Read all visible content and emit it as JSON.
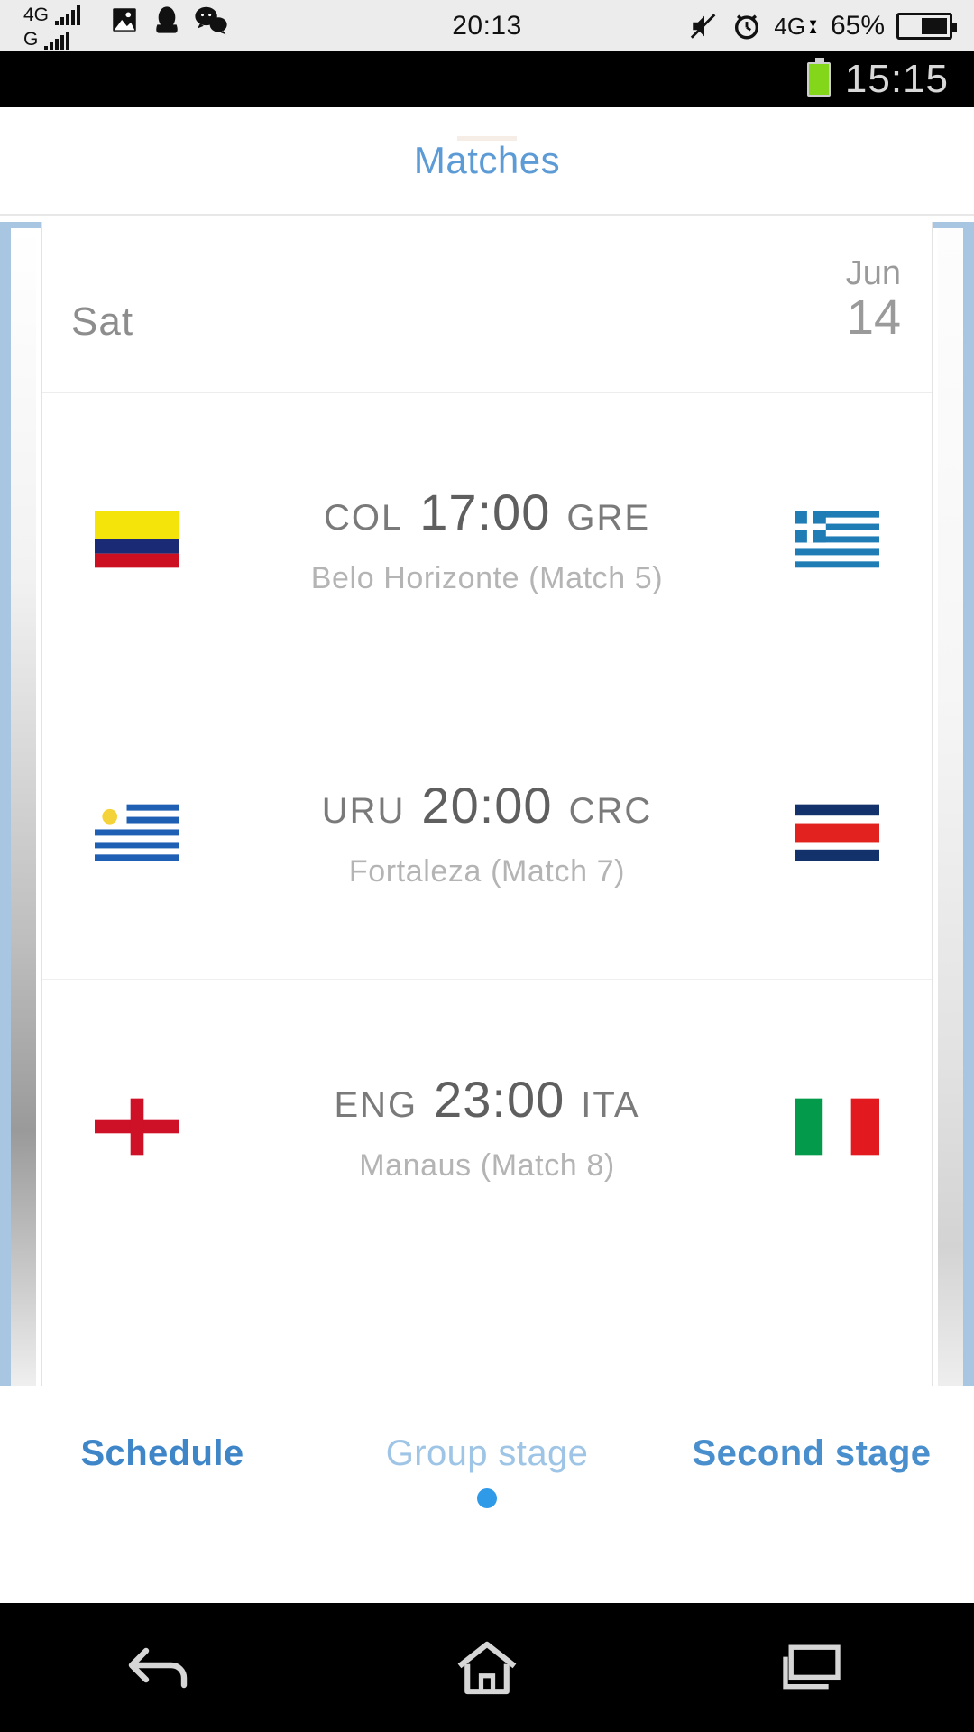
{
  "system_bar": {
    "network_primary": "4G",
    "network_secondary": "G",
    "clock": "20:13",
    "battery_percent": "65%",
    "icons": [
      "photo-icon",
      "qq-penguin-icon",
      "wechat-icon",
      "mute-icon",
      "alarm-icon",
      "data-transfer-icon",
      "battery-icon"
    ]
  },
  "device_status": {
    "clock": "15:15",
    "battery_icon": "battery-full-icon"
  },
  "app": {
    "title": "Matches",
    "accent_color": "#5c9bd6",
    "frame_color": "#a8c6e2"
  },
  "date_header": {
    "weekday": "Sat",
    "month": "Jun",
    "day": "14"
  },
  "matches": [
    {
      "home_code": "COL",
      "home_flag": "colombia-flag",
      "time": "17:00",
      "away_code": "GRE",
      "away_flag": "greece-flag",
      "venue": "Belo Horizonte (Match  5)"
    },
    {
      "home_code": "URU",
      "home_flag": "uruguay-flag",
      "time": "20:00",
      "away_code": "CRC",
      "away_flag": "costa-rica-flag",
      "venue": "Fortaleza (Match  7)"
    },
    {
      "home_code": "ENG",
      "home_flag": "england-flag",
      "time": "23:00",
      "away_code": "ITA",
      "away_flag": "italy-flag",
      "venue": "Manaus (Match  8)"
    }
  ],
  "tabs": [
    {
      "label": "Schedule",
      "state": "active"
    },
    {
      "label": "Group stage",
      "state": "dim"
    },
    {
      "label": "Second stage",
      "state": "side"
    }
  ],
  "pager": {
    "active_index": 0,
    "dot_color": "#2f9ae8"
  },
  "nav": {
    "back": "back-icon",
    "home": "home-icon",
    "recents": "recents-icon"
  }
}
